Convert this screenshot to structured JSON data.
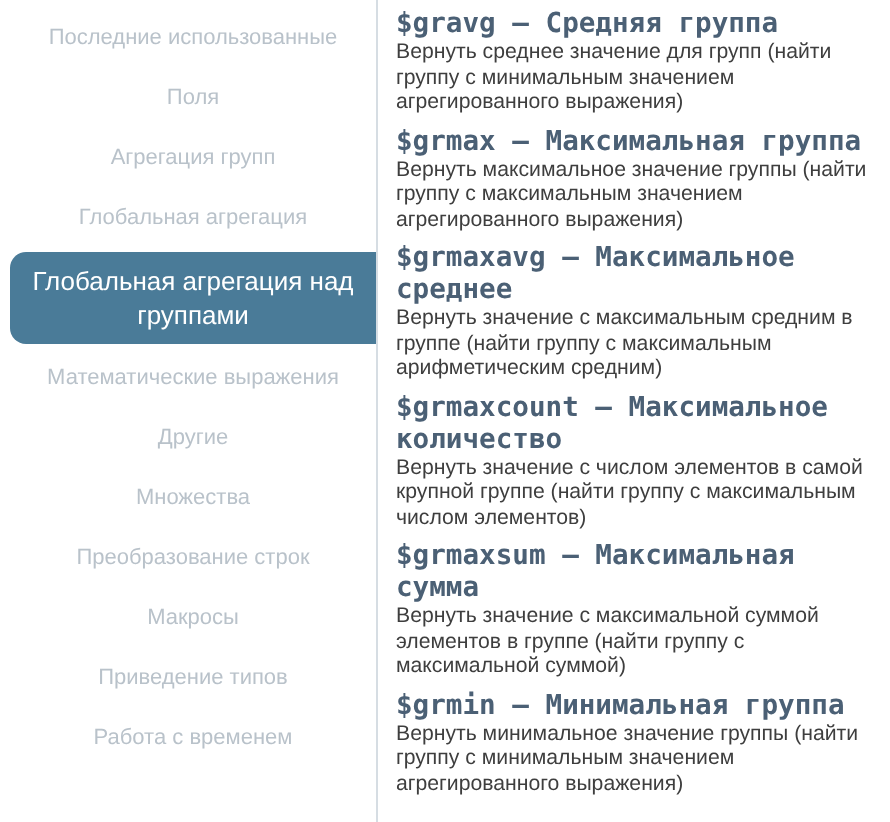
{
  "sidebar": {
    "items": [
      {
        "label": "Последние использованные",
        "selected": false
      },
      {
        "label": "Поля",
        "selected": false
      },
      {
        "label": "Агрегация групп",
        "selected": false
      },
      {
        "label": "Глобальная агрегация",
        "selected": false
      },
      {
        "label": "Глобальная агрегация над группами",
        "selected": true
      },
      {
        "label": "Математические выражения",
        "selected": false
      },
      {
        "label": "Другие",
        "selected": false
      },
      {
        "label": "Множества",
        "selected": false
      },
      {
        "label": "Преобразование строк",
        "selected": false
      },
      {
        "label": "Макросы",
        "selected": false
      },
      {
        "label": "Приведение типов",
        "selected": false
      },
      {
        "label": "Работа с временем",
        "selected": false
      }
    ]
  },
  "functions": [
    {
      "title": "$gravg – Средняя группа",
      "description": "Вернуть среднее значение для групп (найти группу с минимальным значением агрегированного выражения)"
    },
    {
      "title": "$grmax – Максимальная группа",
      "description": "Вернуть максимальное значение группы (найти группу с максимальным значением агрегированного выражения)"
    },
    {
      "title": "$grmaxavg – Максимальное среднее",
      "description": "Вернуть значение с максимальным средним в группе (найти группу с максимальным арифметическим средним)"
    },
    {
      "title": "$grmaxcount – Максимальное количество",
      "description": "Вернуть значение с числом элементов в самой крупной группе (найти группу с максимальным числом элементов)"
    },
    {
      "title": "$grmaxsum – Максимальная сумма",
      "description": "Вернуть значение с максимальной суммой элементов в группе (найти группу с максимальной суммой)"
    },
    {
      "title": "$grmin – Минимальная группа",
      "description": "Вернуть минимальное значение группы (найти группу с минимальным значением агрегированного выражения)"
    }
  ]
}
